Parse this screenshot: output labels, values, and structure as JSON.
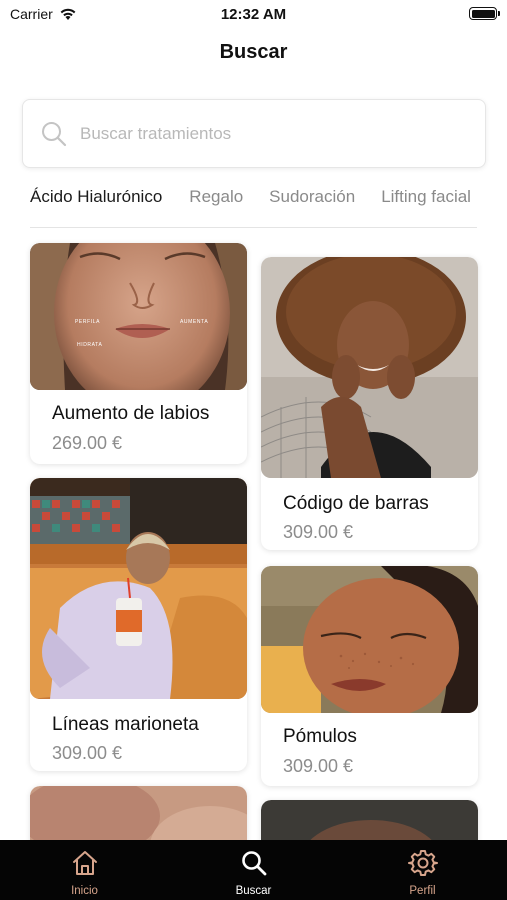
{
  "status_bar": {
    "carrier": "Carrier",
    "time": "12:32 AM"
  },
  "header": {
    "title": "Buscar"
  },
  "search": {
    "placeholder": "Buscar tratamientos",
    "value": ""
  },
  "filter_tabs": [
    "Ácido Hialurónico",
    "Regalo",
    "Sudoración",
    "Lifting facial"
  ],
  "active_filter_tab": "Ácido Hialurónico",
  "treatments": [
    {
      "name": "Aumento de labios",
      "price": "269.00 €",
      "photo_labels": [
        "PERFILA",
        "AUMENTA",
        "HIDRATA"
      ]
    },
    {
      "name": "Código de barras",
      "price": "309.00 €"
    },
    {
      "name": "Líneas marioneta",
      "price": "309.00 €"
    },
    {
      "name": "Pómulos",
      "price": "309.00 €"
    }
  ],
  "tab_bar": {
    "items": [
      {
        "label": "Inicio",
        "icon": "home-icon",
        "color": "#d7a58c"
      },
      {
        "label": "Buscar",
        "icon": "search-icon",
        "color": "#ffffff"
      },
      {
        "label": "Perfil",
        "icon": "gear-icon",
        "color": "#d7a58c"
      }
    ]
  },
  "colors": {
    "accent": "#d7a58c",
    "tab_bar_bg": "#050505",
    "muted_text": "#8c8c8c"
  }
}
